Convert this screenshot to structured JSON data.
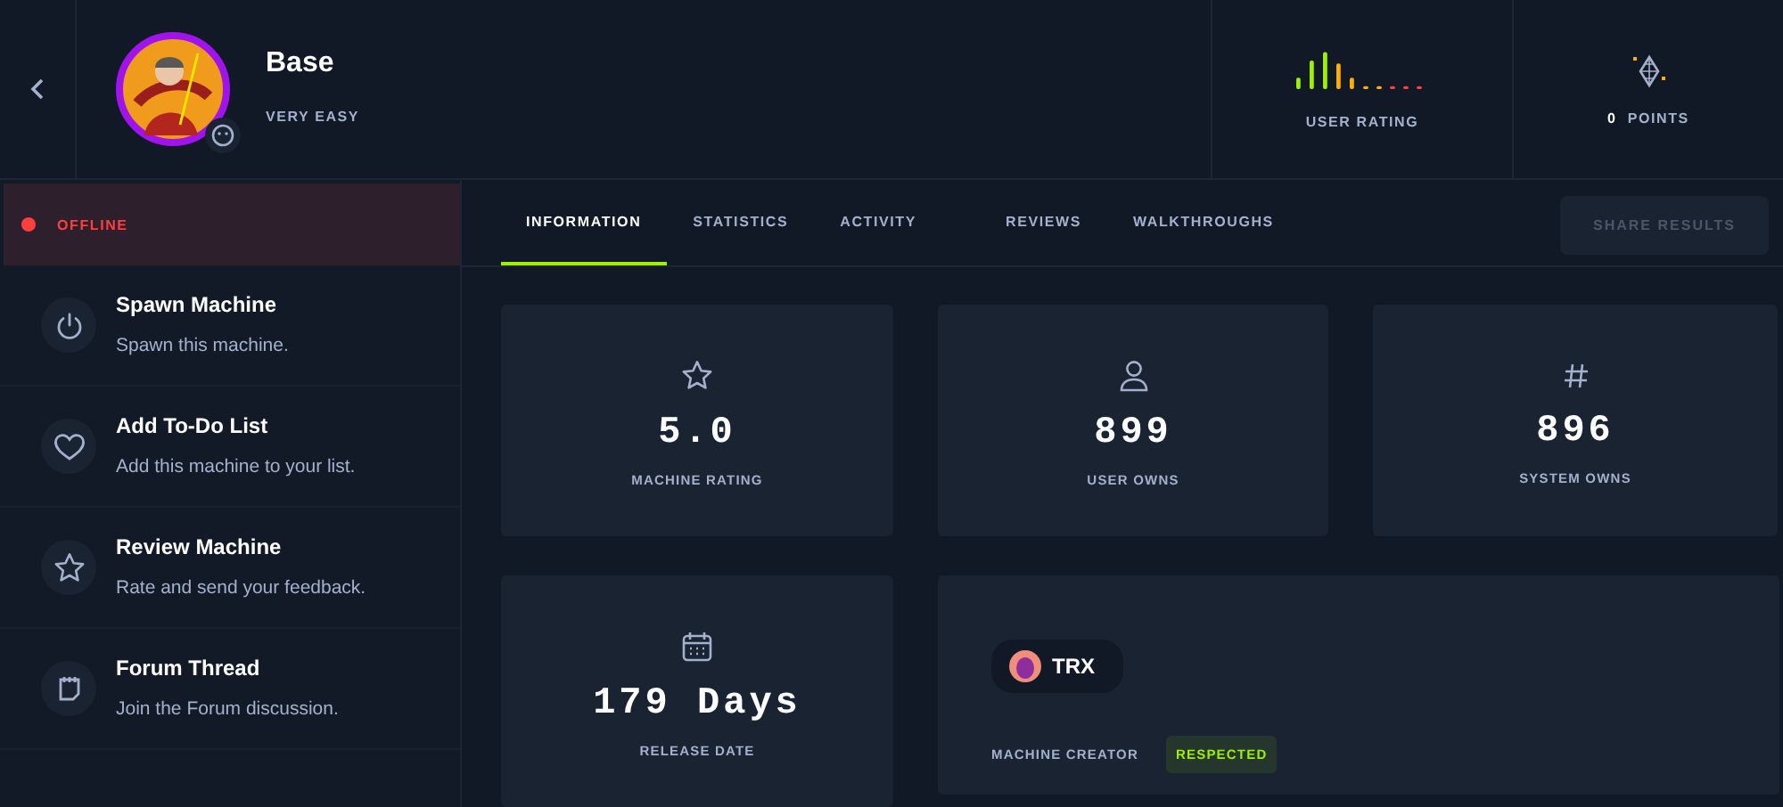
{
  "machine": {
    "name": "Base",
    "difficulty": "VERY EASY"
  },
  "user_rating": {
    "label": "USER RATING"
  },
  "points": {
    "value": "0",
    "label": "POINTS"
  },
  "status": {
    "label": "OFFLINE",
    "online": false
  },
  "actions": [
    {
      "kind": "power",
      "title": "Spawn Machine",
      "subtitle": "Spawn this machine."
    },
    {
      "kind": "heart",
      "title": "Add To-Do List",
      "subtitle": "Add this machine to your list."
    },
    {
      "kind": "star",
      "title": "Review Machine",
      "subtitle": "Rate and send your feedback."
    },
    {
      "kind": "note",
      "title": "Forum Thread",
      "subtitle": "Join the Forum discussion."
    }
  ],
  "tabs": [
    {
      "label": "INFORMATION",
      "selected": true
    },
    {
      "label": "STATISTICS",
      "selected": false
    },
    {
      "label": "ACTIVITY",
      "selected": false
    },
    {
      "label": "REVIEWS",
      "selected": false
    },
    {
      "label": "WALKTHROUGHS",
      "selected": false
    }
  ],
  "share_button": {
    "label": "SHARE RESULTS",
    "disabled": true
  },
  "stats": [
    {
      "kind": "star",
      "value": "5.0",
      "label": "MACHINE RATING"
    },
    {
      "kind": "user",
      "value": "899",
      "label": "USER OWNS"
    },
    {
      "kind": "hash",
      "value": "896",
      "label": "SYSTEM OWNS"
    },
    {
      "kind": "calendar",
      "value": "179 Days",
      "label": "RELEASE DATE"
    }
  ],
  "creator": {
    "name": "TRX",
    "label": "MACHINE CREATOR",
    "badge": "RESPECTED"
  }
}
